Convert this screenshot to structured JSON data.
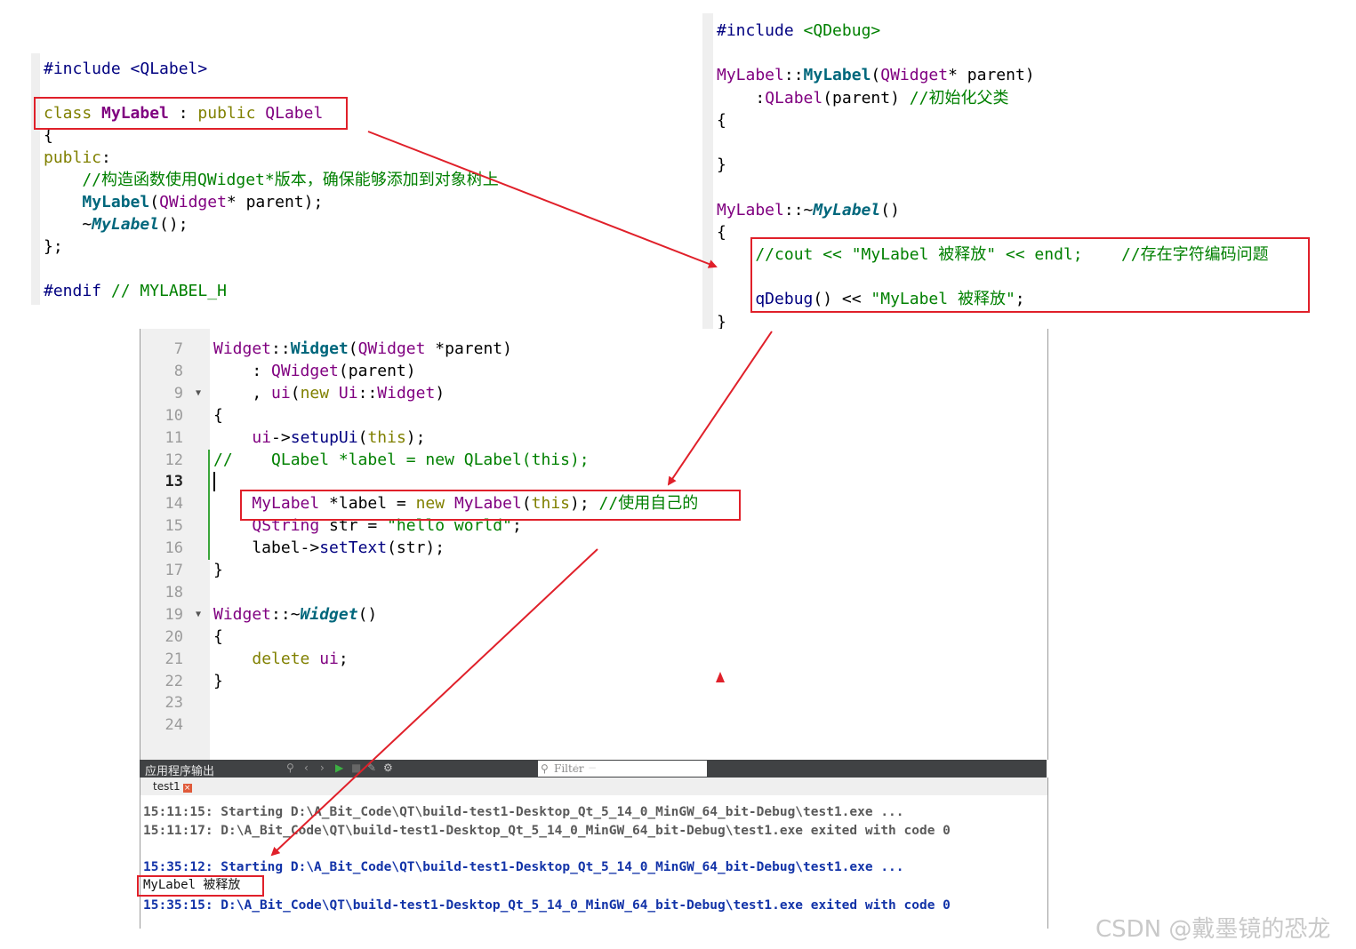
{
  "header_file": {
    "lines": [
      [
        {
          "t": "#include <QLabel>",
          "c": "pp"
        }
      ],
      [],
      [
        {
          "t": "class ",
          "c": "kw"
        },
        {
          "t": "MyLabel",
          "c": "cls-b"
        },
        {
          "t": " : ",
          "c": "plain"
        },
        {
          "t": "public ",
          "c": "kw"
        },
        {
          "t": "QLabel",
          "c": "cls"
        }
      ],
      [
        {
          "t": "{",
          "c": "plain"
        }
      ],
      [
        {
          "t": "public",
          "c": "kw"
        },
        {
          "t": ":",
          "c": "plain"
        }
      ],
      [
        {
          "t": "    //构造函数使用QWidget*版本，确保能够添加到对象树上",
          "c": "cm"
        }
      ],
      [
        {
          "t": "    ",
          "c": "plain"
        },
        {
          "t": "MyLabel",
          "c": "fn-bold"
        },
        {
          "t": "(",
          "c": "plain"
        },
        {
          "t": "QWidget",
          "c": "cls"
        },
        {
          "t": "* parent);",
          "c": "plain"
        }
      ],
      [
        {
          "t": "    ~",
          "c": "plain"
        },
        {
          "t": "MyLabel",
          "c": "fn-it"
        },
        {
          "t": "();",
          "c": "plain"
        }
      ],
      [
        {
          "t": "};",
          "c": "plain"
        }
      ],
      [],
      [
        {
          "t": "#endif ",
          "c": "pp"
        },
        {
          "t": "// MYLABEL_H",
          "c": "cm"
        }
      ]
    ]
  },
  "cpp_file": {
    "lines": [
      [
        {
          "t": "#include ",
          "c": "pp"
        },
        {
          "t": "<QDebug>",
          "c": "str"
        }
      ],
      [],
      [
        {
          "t": "MyLabel",
          "c": "cls"
        },
        {
          "t": "::",
          "c": "plain"
        },
        {
          "t": "MyLabel",
          "c": "fn-bold"
        },
        {
          "t": "(",
          "c": "plain"
        },
        {
          "t": "QWidget",
          "c": "cls"
        },
        {
          "t": "* parent)",
          "c": "plain"
        }
      ],
      [
        {
          "t": "    :",
          "c": "plain"
        },
        {
          "t": "QLabel",
          "c": "cls"
        },
        {
          "t": "(parent) ",
          "c": "plain"
        },
        {
          "t": "//初始化父类",
          "c": "cm"
        }
      ],
      [
        {
          "t": "{",
          "c": "plain"
        }
      ],
      [],
      [
        {
          "t": "}",
          "c": "plain"
        }
      ],
      [],
      [
        {
          "t": "MyLabel",
          "c": "cls"
        },
        {
          "t": "::~",
          "c": "plain"
        },
        {
          "t": "MyLabel",
          "c": "fn-it"
        },
        {
          "t": "()",
          "c": "plain"
        }
      ],
      [
        {
          "t": "{",
          "c": "plain"
        }
      ],
      [
        {
          "t": "    //cout << \"MyLabel 被释放\" << endl;    //存在字符编码问题",
          "c": "cm"
        }
      ],
      [],
      [
        {
          "t": "    qDebug",
          "c": "pp"
        },
        {
          "t": "() << ",
          "c": "plain"
        },
        {
          "t": "\"MyLabel 被释放\"",
          "c": "str"
        },
        {
          "t": ";",
          "c": "plain"
        }
      ],
      [
        {
          "t": "}",
          "c": "plain"
        }
      ]
    ]
  },
  "editor": {
    "line_numbers": [
      "7",
      "8",
      "9",
      "10",
      "11",
      "12",
      "13",
      "14",
      "15",
      "16",
      "17",
      "18",
      "19",
      "20",
      "21",
      "22",
      "23",
      "24"
    ],
    "current_line": "13",
    "lines": [
      [
        {
          "t": "Widget",
          "c": "cls"
        },
        {
          "t": "::",
          "c": "plain"
        },
        {
          "t": "Widget",
          "c": "fn-bold"
        },
        {
          "t": "(",
          "c": "plain"
        },
        {
          "t": "QWidget",
          "c": "cls"
        },
        {
          "t": " *parent)",
          "c": "plain"
        }
      ],
      [
        {
          "t": "    : ",
          "c": "plain"
        },
        {
          "t": "QWidget",
          "c": "cls"
        },
        {
          "t": "(parent)",
          "c": "plain"
        }
      ],
      [
        {
          "t": "    , ",
          "c": "plain"
        },
        {
          "t": "ui",
          "c": "cls"
        },
        {
          "t": "(",
          "c": "plain"
        },
        {
          "t": "new ",
          "c": "kw"
        },
        {
          "t": "Ui",
          "c": "cls"
        },
        {
          "t": "::",
          "c": "plain"
        },
        {
          "t": "Widget",
          "c": "cls"
        },
        {
          "t": ")",
          "c": "plain"
        }
      ],
      [
        {
          "t": "{",
          "c": "plain"
        }
      ],
      [
        {
          "t": "    ",
          "c": "plain"
        },
        {
          "t": "ui",
          "c": "cls"
        },
        {
          "t": "->",
          "c": "plain"
        },
        {
          "t": "setupUi",
          "c": "pp"
        },
        {
          "t": "(",
          "c": "plain"
        },
        {
          "t": "this",
          "c": "kw"
        },
        {
          "t": ");",
          "c": "plain"
        }
      ],
      [
        {
          "t": "//    QLabel *label = new QLabel(this);",
          "c": "cm"
        }
      ],
      [],
      [
        {
          "t": "    ",
          "c": "plain"
        },
        {
          "t": "MyLabel",
          "c": "cls"
        },
        {
          "t": " *label = ",
          "c": "plain"
        },
        {
          "t": "new ",
          "c": "kw"
        },
        {
          "t": "MyLabel",
          "c": "cls"
        },
        {
          "t": "(",
          "c": "plain"
        },
        {
          "t": "this",
          "c": "kw"
        },
        {
          "t": "); ",
          "c": "plain"
        },
        {
          "t": "//使用自己的",
          "c": "cm"
        }
      ],
      [
        {
          "t": "    ",
          "c": "plain"
        },
        {
          "t": "QString",
          "c": "cls"
        },
        {
          "t": " str = ",
          "c": "plain"
        },
        {
          "t": "\"hello world\"",
          "c": "str"
        },
        {
          "t": ";",
          "c": "plain"
        }
      ],
      [
        {
          "t": "    label->",
          "c": "plain"
        },
        {
          "t": "setText",
          "c": "pp"
        },
        {
          "t": "(str);",
          "c": "plain"
        }
      ],
      [
        {
          "t": "}",
          "c": "plain"
        }
      ],
      [],
      [
        {
          "t": "Widget",
          "c": "cls"
        },
        {
          "t": "::~",
          "c": "plain"
        },
        {
          "t": "Widget",
          "c": "fn-it"
        },
        {
          "t": "()",
          "c": "plain"
        }
      ],
      [
        {
          "t": "{",
          "c": "plain"
        }
      ],
      [
        {
          "t": "    ",
          "c": "plain"
        },
        {
          "t": "delete ",
          "c": "kw"
        },
        {
          "t": "ui",
          "c": "cls"
        },
        {
          "t": ";",
          "c": "plain"
        }
      ],
      [
        {
          "t": "}",
          "c": "plain"
        }
      ],
      [],
      []
    ]
  },
  "output_panel": {
    "title": "应用程序输出",
    "filter_placeholder": "Filter",
    "tab_label": "test1",
    "lines": [
      {
        "text": "15:11:15: Starting D:\\A_Bit_Code\\QT\\build-test1-Desktop_Qt_5_14_0_MinGW_64_bit-Debug\\test1.exe ...",
        "style": "gray"
      },
      {
        "text": "15:11:17: D:\\A_Bit_Code\\QT\\build-test1-Desktop_Qt_5_14_0_MinGW_64_bit-Debug\\test1.exe exited with code 0",
        "style": "gray"
      },
      {
        "text": "",
        "style": "gray"
      },
      {
        "text": "15:35:12: Starting D:\\A_Bit_Code\\QT\\build-test1-Desktop_Qt_5_14_0_MinGW_64_bit-Debug\\test1.exe ...",
        "style": "blue"
      },
      {
        "text": "MyLabel 被释放",
        "style": "plain"
      },
      {
        "text": "15:35:15: D:\\A_Bit_Code\\QT\\build-test1-Desktop_Qt_5_14_0_MinGW_64_bit-Debug\\test1.exe exited with code 0",
        "style": "blue"
      }
    ]
  },
  "watermark": "CSDN @戴墨镜的恐龙",
  "colors": {
    "annotation": "#e0202a",
    "keyword": "#808000",
    "class": "#800080",
    "function": "#00677c",
    "comment": "#008000"
  }
}
